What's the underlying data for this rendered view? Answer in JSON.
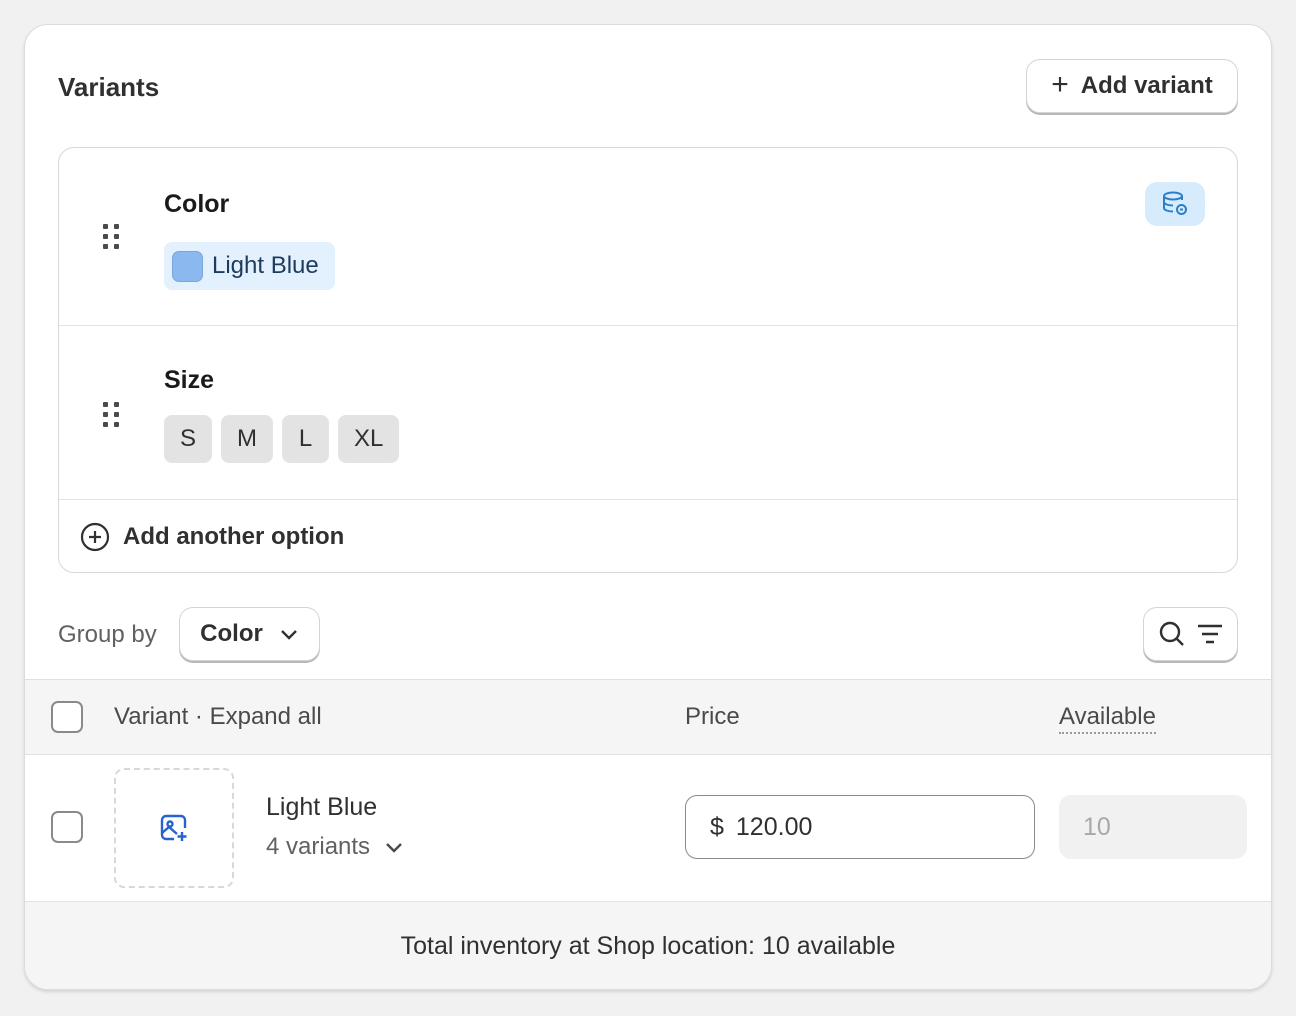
{
  "card": {
    "title": "Variants",
    "add_variant_label": "Add variant"
  },
  "options": [
    {
      "name": "Color",
      "values": [
        {
          "label": "Light Blue",
          "swatch": "#8ab8ef"
        }
      ]
    },
    {
      "name": "Size",
      "values": [
        "S",
        "M",
        "L",
        "XL"
      ]
    }
  ],
  "add_option_label": "Add another option",
  "group_by": {
    "label": "Group by",
    "selected": "Color"
  },
  "table": {
    "headers": {
      "variant": "Variant · Expand all",
      "price": "Price",
      "available": "Available"
    },
    "rows": [
      {
        "title": "Light Blue",
        "subtitle": "4 variants",
        "currency": "$",
        "price": "120.00",
        "available": "10"
      }
    ]
  },
  "footer": {
    "text": "Total inventory at Shop location: 10 available"
  },
  "icons": {
    "add": "plus-icon",
    "drag": "drag-handle-icon",
    "metafield": "database-link-icon",
    "add_option": "plus-circle-icon",
    "chevron": "chevron-down-icon",
    "search": "search-icon",
    "filter": "filter-icon",
    "image": "image-add-icon"
  },
  "colors": {
    "accent_blue": "#2463d0",
    "chip_blue_bg": "#e3f0fd",
    "metafield_bg": "#d6ecfc"
  }
}
